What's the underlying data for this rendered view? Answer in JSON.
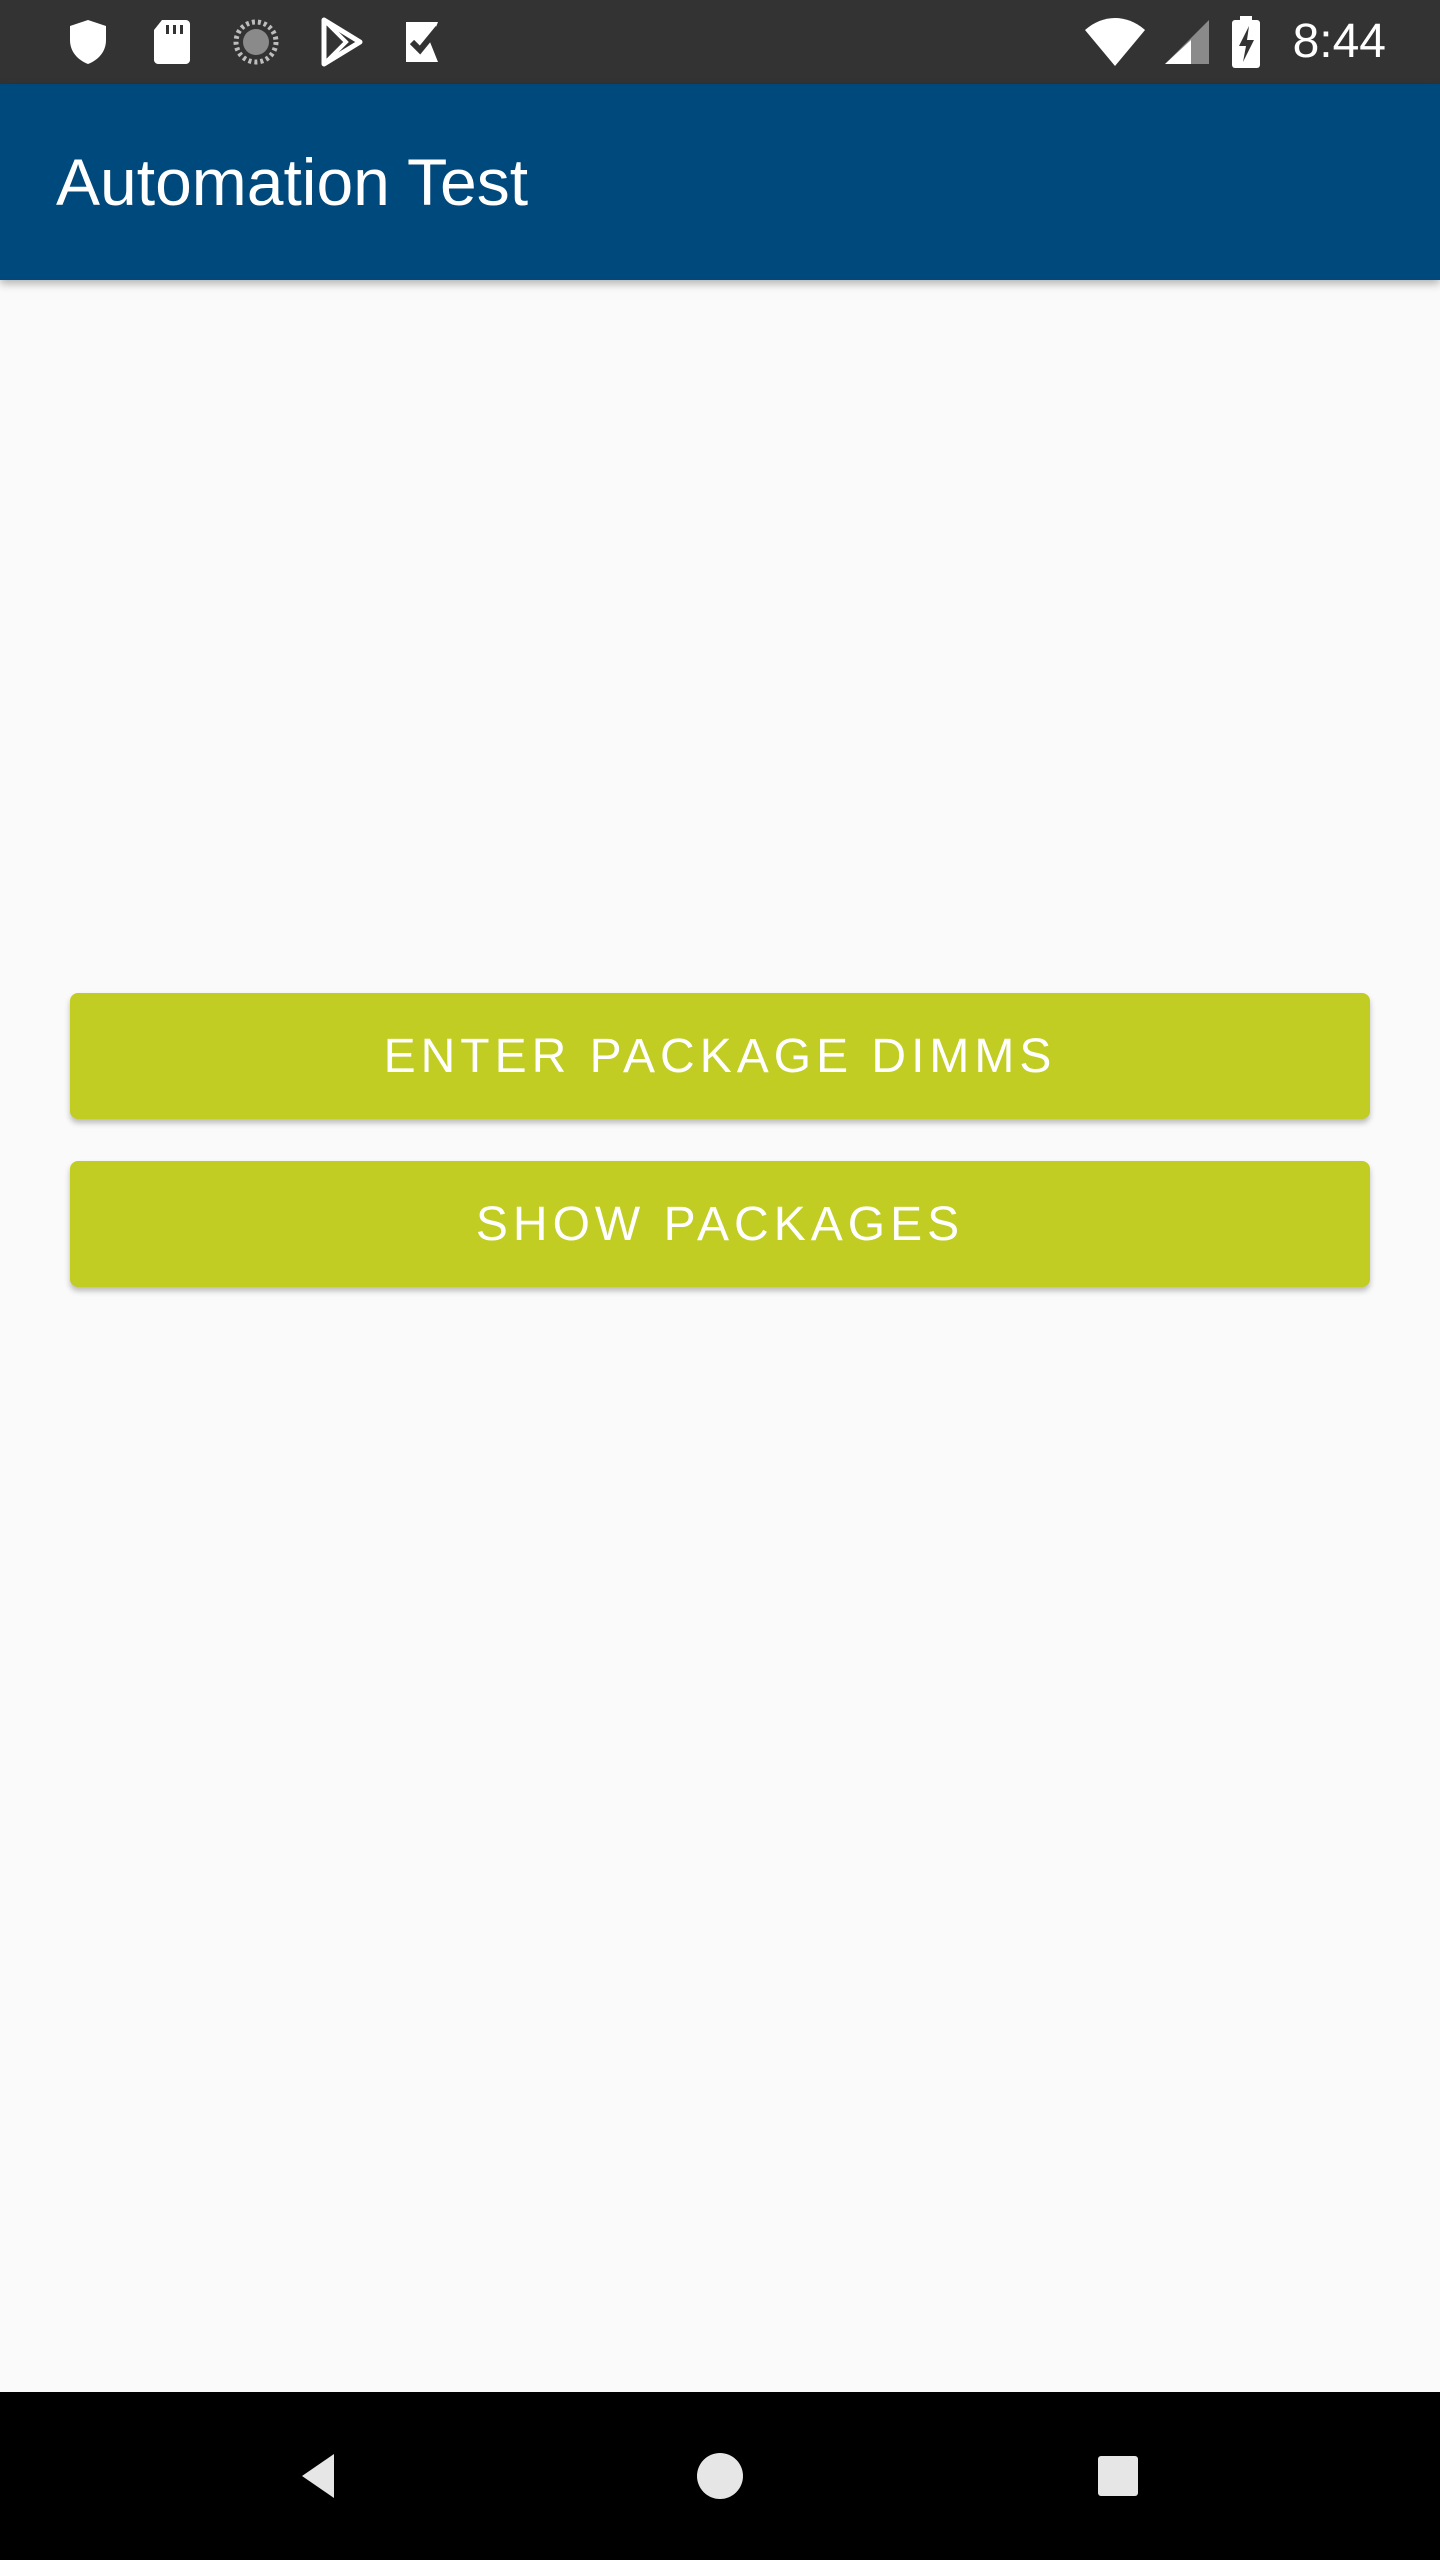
{
  "status_bar": {
    "time": "8:44",
    "left_icons": [
      "shield-icon",
      "sd-card-icon",
      "sync-progress-icon",
      "play-store-icon",
      "task-check-icon"
    ],
    "right_icons": [
      "wifi-icon",
      "cell-signal-icon",
      "battery-charging-icon"
    ],
    "background_color": "#333333"
  },
  "app_bar": {
    "title": "Automation Test",
    "background_color": "#00497d"
  },
  "main": {
    "buttons": [
      {
        "label": "ENTER PACKAGE DIMMS"
      },
      {
        "label": "SHOW PACKAGES"
      }
    ],
    "button_color": "#c1cd23",
    "background_color": "#fafafa"
  },
  "nav_bar": {
    "icons": [
      "back-icon",
      "home-icon",
      "recents-icon"
    ],
    "background_color": "#000000"
  }
}
